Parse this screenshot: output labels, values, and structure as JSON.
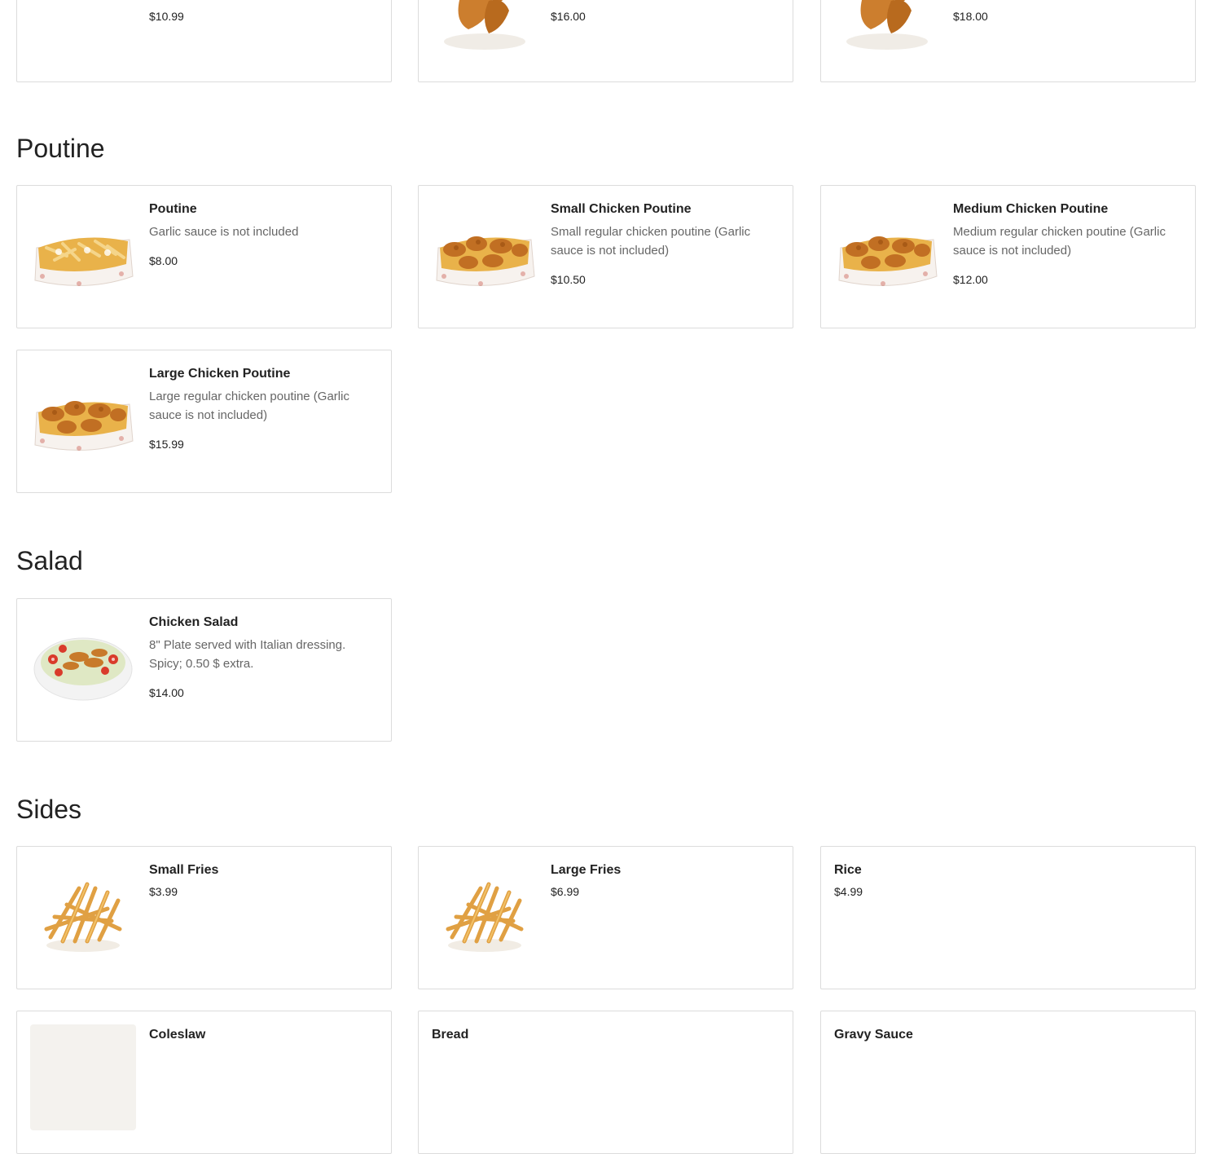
{
  "sections": {
    "previous": {
      "items": [
        {
          "price": "$10.99",
          "icon": "sandwich-image"
        },
        {
          "price": "$16.00",
          "icon": "chicken-tenders-image"
        },
        {
          "price": "$18.00",
          "icon": "chicken-tenders-image"
        }
      ]
    },
    "poutine": {
      "title": "Poutine",
      "items": [
        {
          "name": "Poutine",
          "desc": "Garlic sauce is not included",
          "price": "$8.00",
          "icon": "poutine-image"
        },
        {
          "name": "Small Chicken Poutine",
          "desc": "Small regular chicken poutine (Garlic sauce is not included)",
          "price": "$10.50",
          "icon": "chicken-poutine-image"
        },
        {
          "name": "Medium Chicken Poutine",
          "desc": "Medium regular chicken poutine (Garlic sauce is not included)",
          "price": "$12.00",
          "icon": "chicken-poutine-image"
        },
        {
          "name": "Large Chicken Poutine",
          "desc": "Large regular chicken poutine (Garlic sauce is not included)",
          "price": "$15.99",
          "icon": "chicken-poutine-image"
        }
      ]
    },
    "salad": {
      "title": "Salad",
      "items": [
        {
          "name": "Chicken Salad",
          "desc": "8\" Plate served with Italian dressing. Spicy; 0.50 $ extra.",
          "price": "$14.00",
          "icon": "salad-image"
        }
      ]
    },
    "sides": {
      "title": "Sides",
      "items": [
        {
          "name": "Small Fries",
          "price": "$3.99",
          "icon": "fries-image"
        },
        {
          "name": "Large Fries",
          "price": "$6.99",
          "icon": "fries-image"
        },
        {
          "name": "Rice",
          "price": "$4.99"
        },
        {
          "name": "Coleslaw",
          "icon": "coleslaw-image"
        },
        {
          "name": "Bread"
        },
        {
          "name": "Gravy Sauce"
        }
      ]
    }
  },
  "colors": {
    "border": "#dcdcdc",
    "text": "#222222",
    "muted": "#666666"
  }
}
